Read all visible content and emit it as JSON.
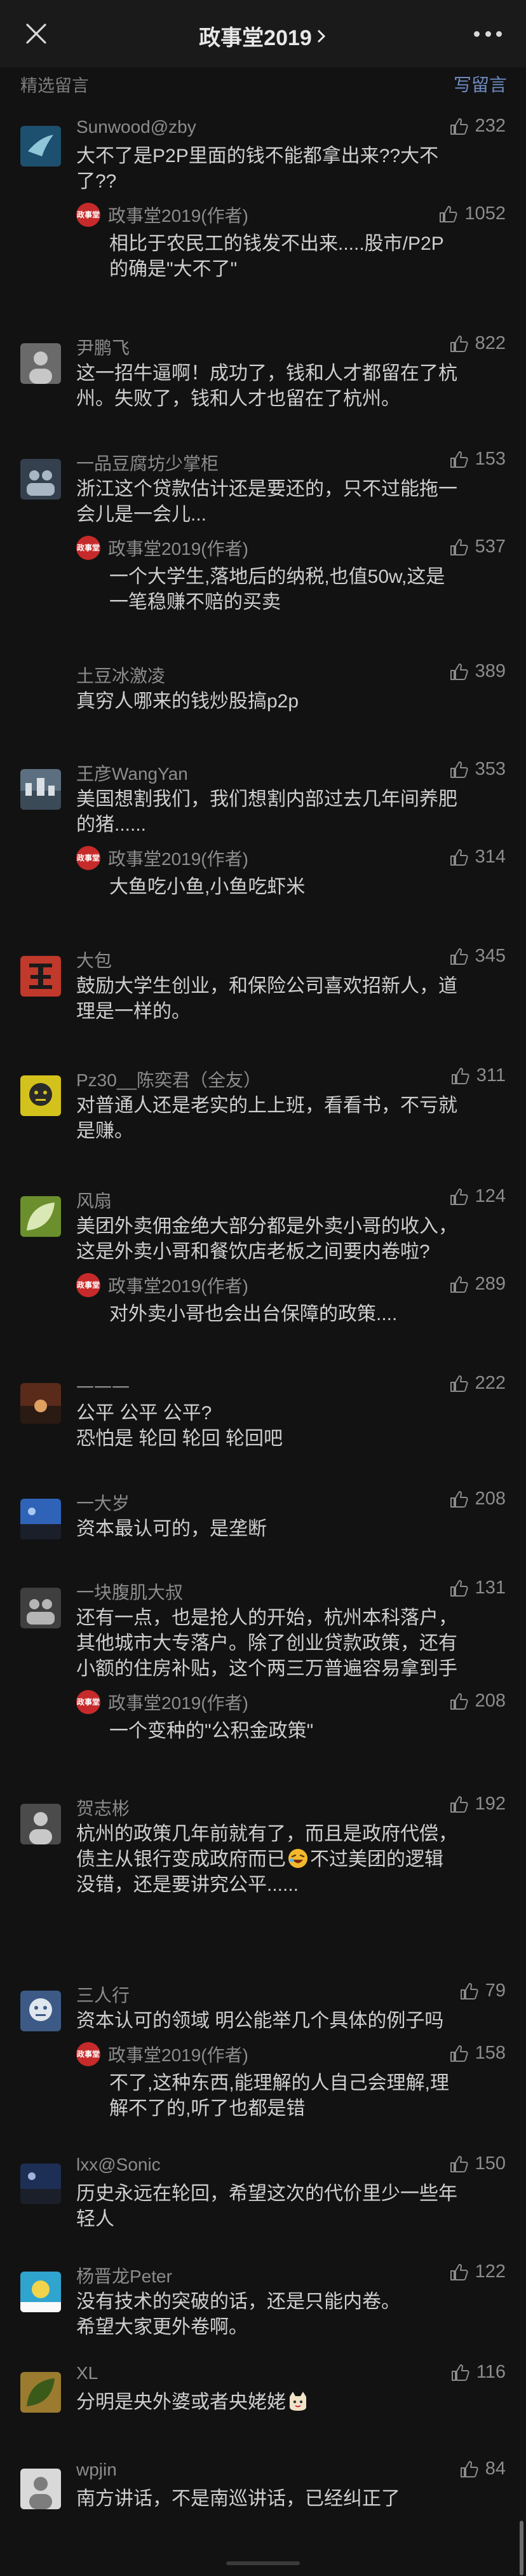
{
  "nav": {
    "title": "政事堂2019",
    "close_icon": "close-icon",
    "more_icon": "more-dots-icon"
  },
  "section": {
    "title": "精选留言",
    "write_label": "写留言"
  },
  "colors": {
    "background": "#121212",
    "link": "#6d8bc2",
    "author_badge": "#c62a2a"
  },
  "author_badge_text": "政事堂",
  "comments": [
    {
      "nickname": "Sunwood@zby",
      "likes": "232",
      "lines": [
        "大不了是P2P里面的钱不能都拿出来??大不",
        "了??"
      ],
      "reply": {
        "name": "政事堂2019(作者)",
        "likes": "1052",
        "lines": [
          "相比于农民工的钱发不出来.....股市/P2P",
          "的确是\"大不了\""
        ]
      }
    },
    {
      "nickname": "尹鹏飞",
      "likes": "822",
      "lines": [
        "这一招牛逼啊！成功了，钱和人才都留在了杭",
        "州。失败了，钱和人才也留在了杭州。"
      ]
    },
    {
      "nickname": "一品豆腐坊少掌柜",
      "likes": "153",
      "lines": [
        "浙江这个贷款估计还是要还的，只不过能拖一",
        "会儿是一会儿..."
      ],
      "reply": {
        "name": "政事堂2019(作者)",
        "likes": "537",
        "lines": [
          "一个大学生,落地后的纳税,也值50w,这是",
          "一笔稳赚不赔的买卖"
        ]
      }
    },
    {
      "nickname": "土豆冰激凌",
      "likes": "389",
      "lines": [
        "真穷人哪来的钱炒股搞p2p"
      ]
    },
    {
      "nickname": "王彦WangYan",
      "likes": "353",
      "lines": [
        "美国想割我们，我们想割内部过去几年间养肥",
        "的猪......"
      ],
      "reply": {
        "name": "政事堂2019(作者)",
        "likes": "314",
        "lines": [
          "大鱼吃小鱼,小鱼吃虾米"
        ]
      }
    },
    {
      "nickname": "大包",
      "likes": "345",
      "lines": [
        "鼓励大学生创业，和保险公司喜欢招新人，道",
        "理是一样的。"
      ]
    },
    {
      "nickname": "Pz30__陈奕君（全友）",
      "likes": "311",
      "lines": [
        "对普通人还是老实的上上班，看看书，不亏就",
        "是赚。"
      ]
    },
    {
      "nickname": "风扇",
      "likes": "124",
      "lines": [
        "美团外卖佣金绝大部分都是外卖小哥的收入，",
        "这是外卖小哥和餐饮店老板之间要内卷啦?"
      ],
      "reply": {
        "name": "政事堂2019(作者)",
        "likes": "289",
        "lines": [
          "对外卖小哥也会出台保障的政策...."
        ]
      }
    },
    {
      "nickname": "一一一",
      "likes": "222",
      "lines": [
        "公平 公平 公平?",
        "恐怕是 轮回 轮回 轮回吧"
      ]
    },
    {
      "nickname": "一大岁",
      "likes": "208",
      "lines": [
        "资本最认可的，是垄断"
      ]
    },
    {
      "nickname": "一块腹肌大叔",
      "likes": "131",
      "lines": [
        "还有一点，也是抢人的开始，杭州本科落户，",
        "其他城市大专落户。除了创业贷款政策，还有",
        "小额的住房补贴，这个两三万普遍容易拿到手"
      ],
      "reply": {
        "name": "政事堂2019(作者)",
        "likes": "208",
        "lines": [
          "一个变种的\"公积金政策\""
        ]
      }
    },
    {
      "nickname": "贺志彬",
      "likes": "192",
      "lines": [
        "杭州的政策几年前就有了，而且是政府代偿，",
        "债主从银行变成政府而已",
        "没错，还是要讲究公平......"
      ],
      "emoji_line": 1,
      "emoji_after": "不过美团的逻辑"
    },
    {
      "nickname": "三人行",
      "likes": "79",
      "lines": [
        "资本认可的领域 明公能举几个具体的例子吗"
      ],
      "reply": {
        "name": "政事堂2019(作者)",
        "likes": "158",
        "lines": [
          "不了,这种东西,能理解的人自己会理解,理",
          "解不了的,听了也都是错"
        ]
      }
    },
    {
      "nickname": "lxx@Sonic",
      "likes": "150",
      "lines": [
        "历史永远在轮回，希望这次的代价里少一些年",
        "轻人"
      ]
    },
    {
      "nickname": "杨晋龙Peter",
      "likes": "122",
      "lines": [
        "没有技术的突破的话，还是只能内卷。",
        "希望大家更外卷啊。"
      ]
    },
    {
      "nickname": "XL",
      "likes": "116",
      "lines": [
        "分明是央外婆或者央姥姥"
      ]
    },
    {
      "nickname": "wpjin",
      "likes": "84",
      "lines": [
        "南方讲话，不是南巡讲话，已经纠正了"
      ]
    }
  ]
}
